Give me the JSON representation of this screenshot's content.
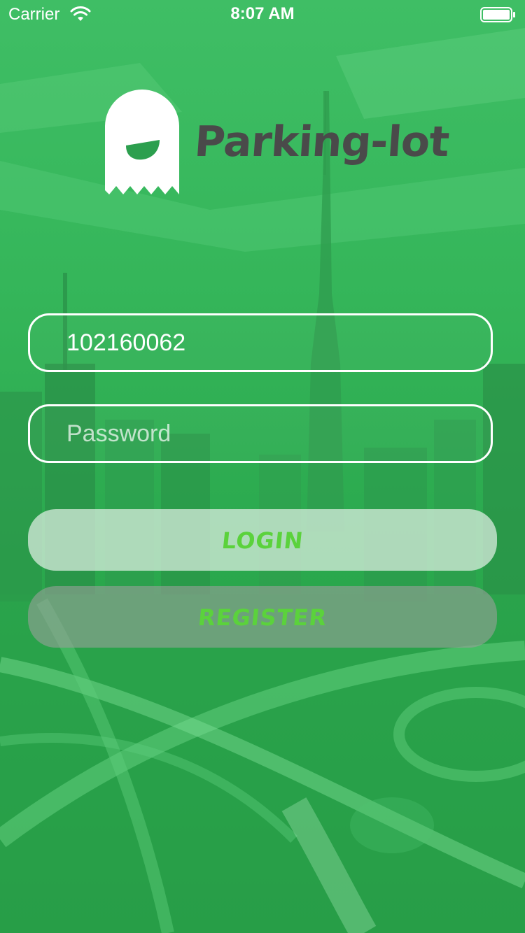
{
  "status_bar": {
    "carrier": "Carrier",
    "time": "8:07 AM",
    "wifi_icon": "wifi-icon",
    "battery_icon": "battery-icon"
  },
  "brand": {
    "logo_icon": "ghost-icon",
    "name": "Parking-lot"
  },
  "form": {
    "username_value": "102160062",
    "password_placeholder": "Password",
    "password_value": ""
  },
  "buttons": {
    "login_label": "LOGIN",
    "register_label": "REGISTER"
  },
  "colors": {
    "background_tint": "#35b65a",
    "button_text": "#5bd23c",
    "brand_text": "#4a4a4a",
    "field_border": "#ffffff"
  }
}
